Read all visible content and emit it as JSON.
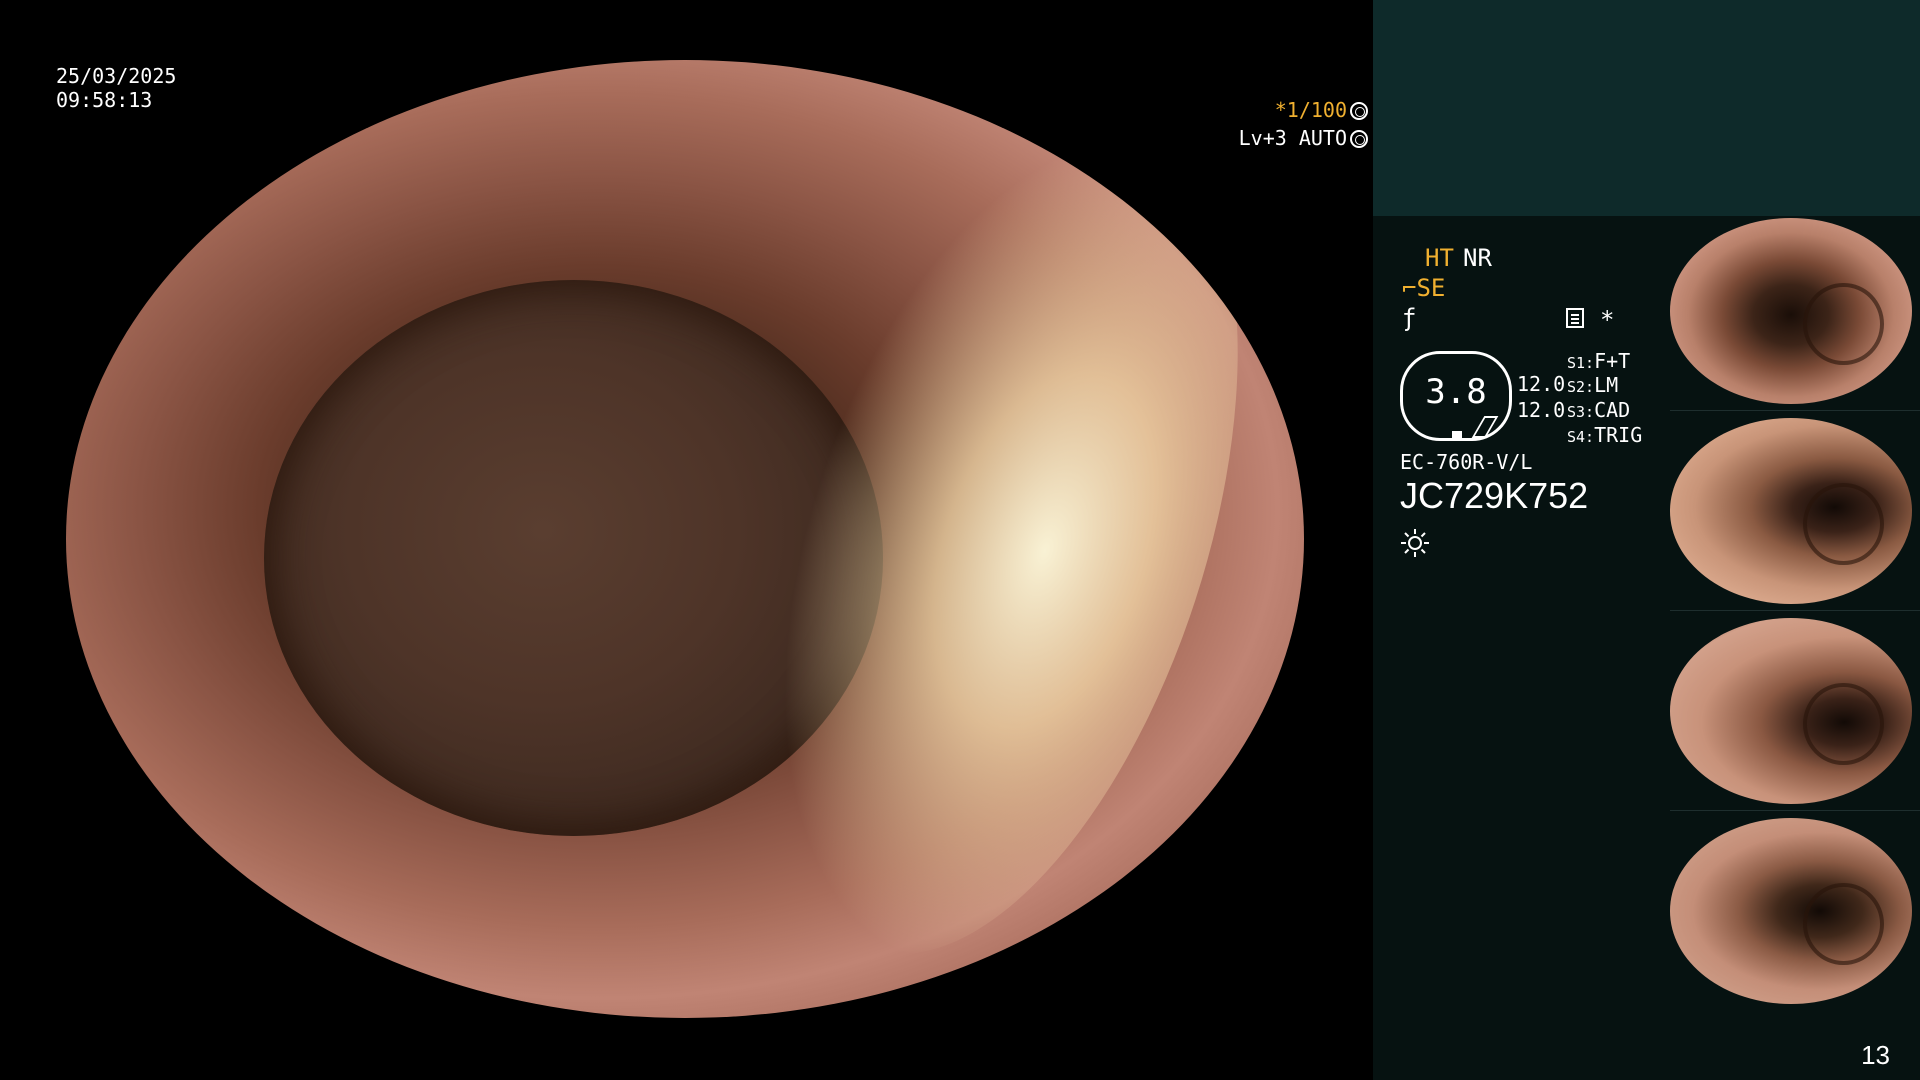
{
  "overlay": {
    "date": "25/03/2025",
    "time": "09:58:13",
    "zoom": "*1/100",
    "level": "Lv+3 AUTO"
  },
  "panel": {
    "ht": "HT",
    "nr": "NR",
    "se": "SE",
    "gauge_value": "3.8",
    "values": [
      "12.0",
      "12.0"
    ],
    "switches": [
      {
        "key": "S1:",
        "value": "F+T"
      },
      {
        "key": "S2:",
        "value": "LM"
      },
      {
        "key": "S3:",
        "value": "CAD"
      },
      {
        "key": "S4:",
        "value": "TRIG"
      }
    ],
    "model": "EC-760R-V/L",
    "serial": "JC729K752",
    "page_number": "13"
  },
  "colors": {
    "accent": "#f0b030",
    "panel_bg": "#061211",
    "panel_header_bg": "#0e2a2a"
  },
  "icons": [
    "shutter-icon",
    "settings-icon",
    "menu-icon",
    "sun-icon"
  ]
}
